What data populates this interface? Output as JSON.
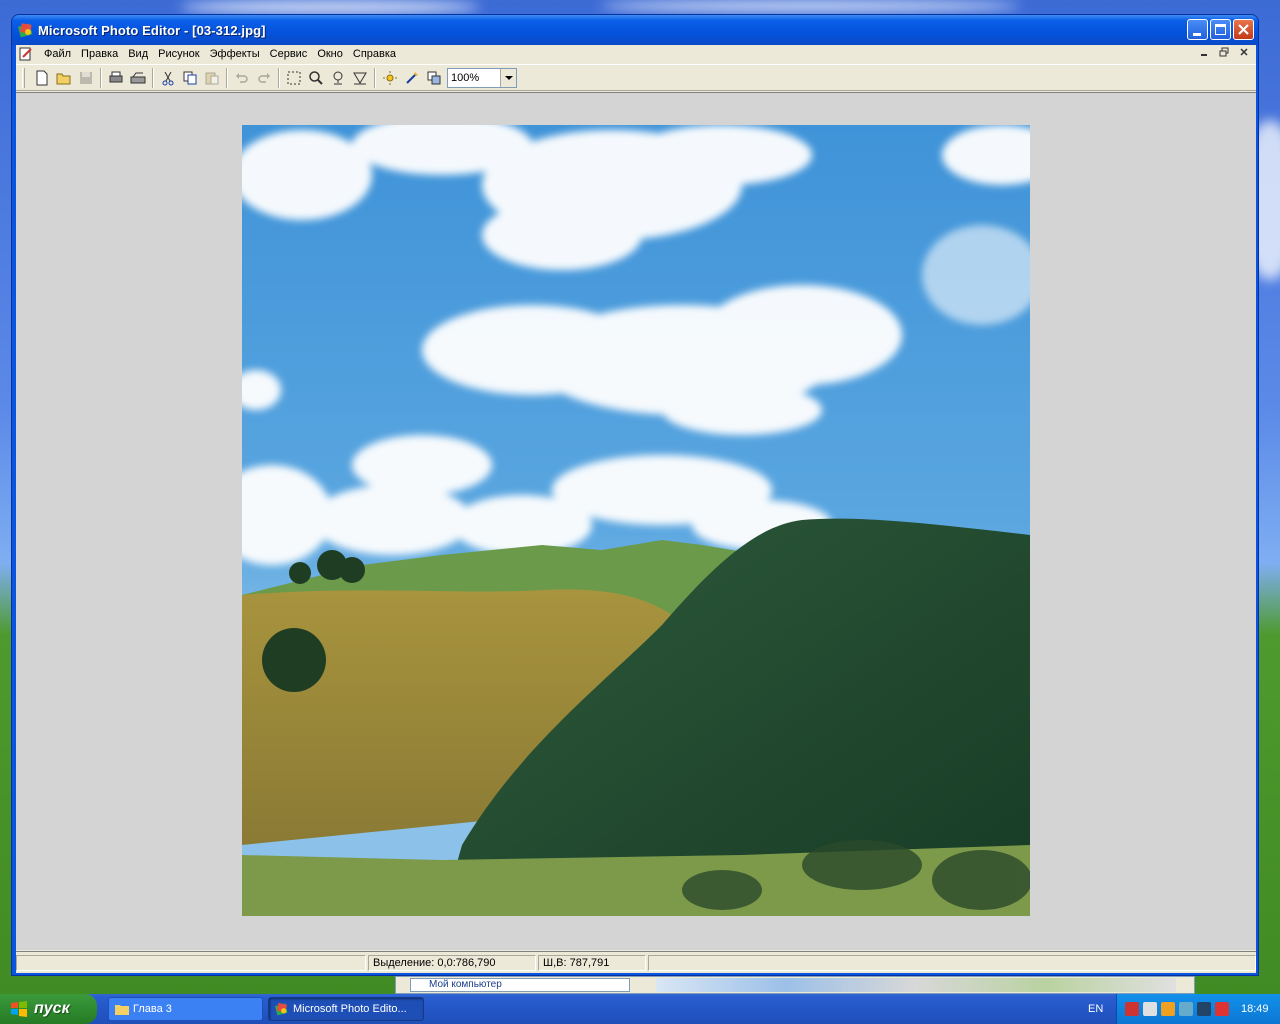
{
  "window": {
    "title": "Microsoft Photo Editor - [03-312.jpg]"
  },
  "menu": [
    "Файл",
    "Правка",
    "Вид",
    "Рисунок",
    "Эффекты",
    "Сервис",
    "Окно",
    "Справка"
  ],
  "toolbar": {
    "zoom_value": "100%",
    "buttons": [
      "new-icon",
      "open-icon",
      "save-icon",
      "print-icon",
      "scan-icon",
      "cut-icon",
      "copy-icon",
      "paste-icon",
      "undo-icon",
      "redo-icon",
      "select-icon",
      "zoom-icon",
      "smudge-icon",
      "sharpen-icon",
      "balance-icon",
      "paintbrush-icon",
      "properties-icon"
    ]
  },
  "statusbar": {
    "selection": "Выделение: 0,0:786,790",
    "size": "Ш,В: 787,791"
  },
  "taskbar": {
    "start_label": "пуск",
    "tasks": [
      "Глава 3",
      "Microsoft Photo Edito..."
    ],
    "language": "EN",
    "clock": "18:49"
  },
  "background_window": {
    "address": "Мой компьютер"
  },
  "colors": {
    "titlebar": "#0552dc",
    "client": "#ece9d8",
    "workspace": "#d4d4d4",
    "taskbar": "#2456c6",
    "start": "#2f8b2f"
  }
}
